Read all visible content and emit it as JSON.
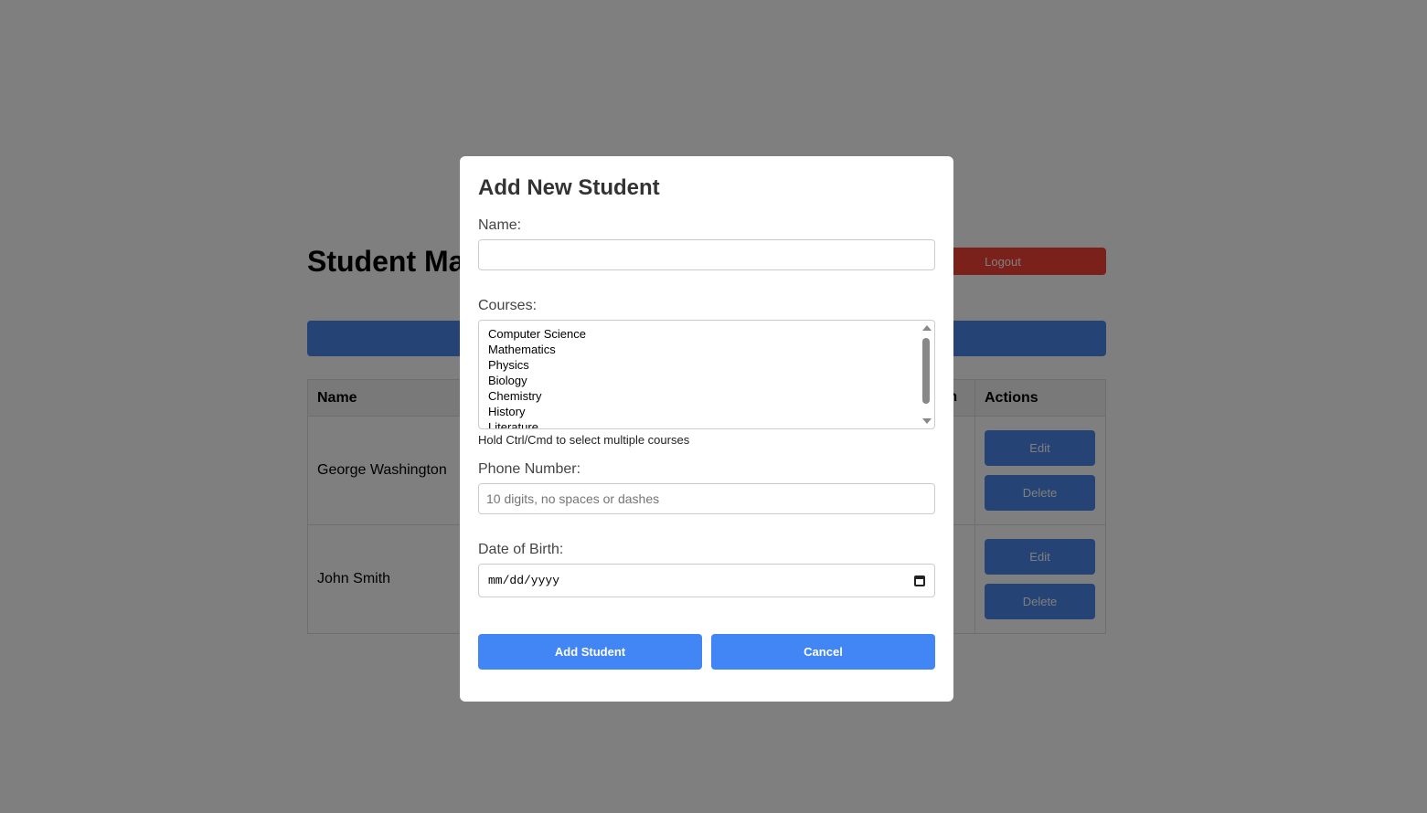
{
  "page": {
    "title": "Student Management",
    "logout_label": "Logout"
  },
  "table": {
    "headers": [
      "Name",
      "Date of Birth",
      "Actions"
    ],
    "header_visible_fragment": "th",
    "rows": [
      {
        "name": "George Washington",
        "edit_label": "Edit",
        "delete_label": "Delete"
      },
      {
        "name": "John Smith",
        "edit_label": "Edit",
        "delete_label": "Delete"
      }
    ]
  },
  "modal": {
    "title": "Add New Student",
    "name_label": "Name:",
    "name_value": "",
    "courses_label": "Courses:",
    "courses": [
      "Computer Science",
      "Mathematics",
      "Physics",
      "Biology",
      "Chemistry",
      "History",
      "Literature"
    ],
    "courses_hint": "Hold Ctrl/Cmd to select multiple courses",
    "phone_label": "Phone Number:",
    "phone_placeholder": "10 digits, no spaces or dashes",
    "dob_label": "Date of Birth:",
    "dob_placeholder": "mm/dd/yyyy",
    "submit_label": "Add Student",
    "cancel_label": "Cancel"
  },
  "colors": {
    "primary": "#4285f4",
    "danger": "#f44336",
    "overlay": "rgba(0,0,0,0.5)"
  },
  "icons": {
    "calendar": "calendar-icon",
    "scroll_up": "scroll-up-icon",
    "scroll_down": "scroll-down-icon"
  }
}
